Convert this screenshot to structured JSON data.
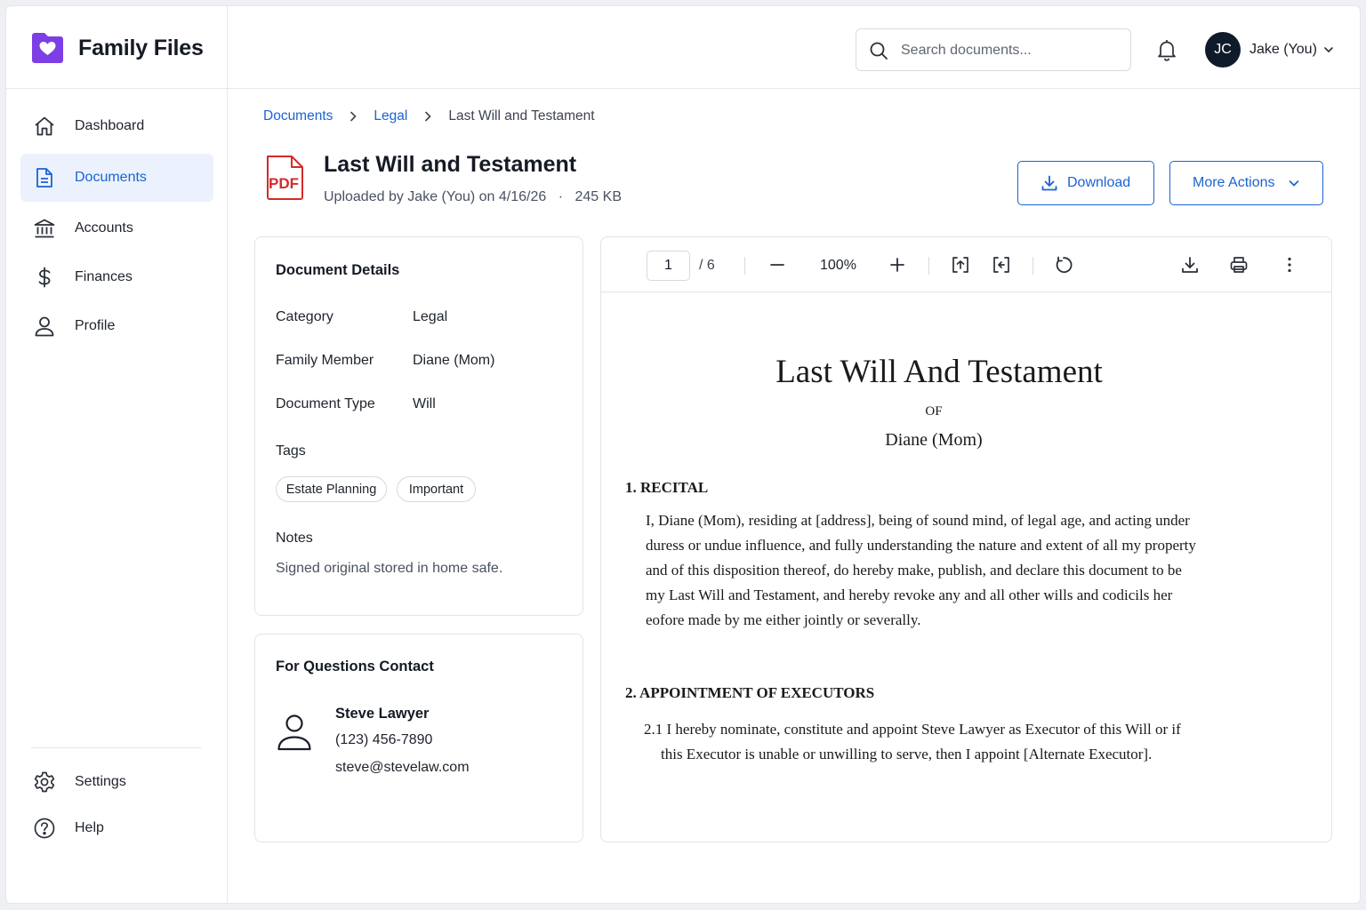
{
  "brand": {
    "name": "Family Files"
  },
  "sidebar": {
    "items": [
      {
        "label": "Dashboard",
        "icon": "home-icon"
      },
      {
        "label": "Documents",
        "icon": "document-icon",
        "active": true
      },
      {
        "label": "Accounts",
        "icon": "bank-icon"
      },
      {
        "label": "Finances",
        "icon": "dollar-icon"
      },
      {
        "label": "Profile",
        "icon": "user-icon"
      }
    ],
    "bottom_items": [
      {
        "label": "Settings",
        "icon": "gear-icon"
      },
      {
        "label": "Help",
        "icon": "help-icon"
      }
    ]
  },
  "header": {
    "search_placeholder": "Search documents...",
    "user_initials": "JC",
    "user_name": "Jake (You)"
  },
  "breadcrumb": {
    "items": [
      "Documents",
      "Legal"
    ],
    "current": "Last Will and Testament"
  },
  "document": {
    "title": "Last Will and Testament",
    "uploaded": "Uploaded by Jake (You) on 4/16/26",
    "size": "245 KB",
    "file_type": "PDF",
    "download_label": "Download",
    "more_actions_label": "More Actions"
  },
  "details": {
    "title": "Document Details",
    "category_label": "Category",
    "category_value": "Legal",
    "member_label": "Family Member",
    "member_value": "Diane (Mom)",
    "type_label": "Document Type",
    "type_value": "Will",
    "tags_label": "Tags",
    "tags": [
      "Estate Planning",
      "Important"
    ],
    "notes_label": "Notes",
    "notes": "Signed original stored in home safe."
  },
  "contact": {
    "title": "For Questions Contact",
    "name": "Steve Lawyer",
    "phone": "(123) 456-7890",
    "email": "steve@stevelaw.com"
  },
  "viewer": {
    "page": "1",
    "total": "/ 6",
    "zoom": "100%",
    "paper": {
      "title": "Last Will And Testament",
      "of": "OF",
      "name": "Diane (Mom)",
      "s1_heading": "1.  RECITAL",
      "s1_lines": [
        "I, Diane (Mom), residing at [address], being of sound mind, of legal age, and acting under",
        "duress or undue influence, and fully understanding the nature and extent of all my property",
        "and of this disposition thereof, do hereby make, publish, and declare this document to be",
        "my Last Will and Testament, and hereby revoke any and all other wills and codicils her",
        "eofore made by me either jointly or severally."
      ],
      "s2_heading": "2.  APPOINTMENT OF EXECUTORS",
      "s2_line1": "2.1 I hereby nominate, constitute and appoint Steve Lawyer as Executor of this Will or if",
      "s2_line2": "this Executor is unable or unwilling to serve, then I appoint [Alternate Executor]."
    }
  },
  "colors": {
    "accent": "#1b63d2",
    "brand": "#7b3fe4",
    "pdf_red": "#d42a2a",
    "active_bg": "#ebf2fd"
  }
}
